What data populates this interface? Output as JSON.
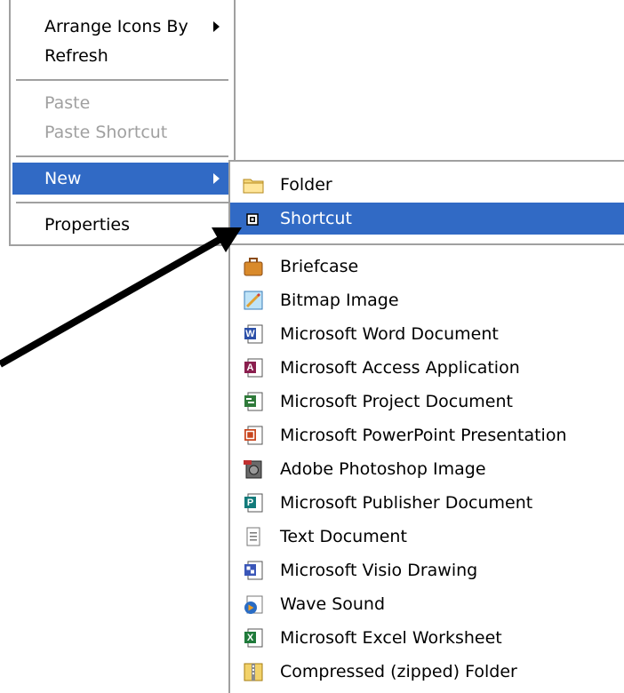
{
  "context_menu": {
    "items": [
      {
        "label": "Arrange Icons By",
        "mnemonic": "I",
        "has_submenu": true,
        "disabled": false
      },
      {
        "label": "Refresh",
        "mnemonic": "e",
        "has_submenu": false,
        "disabled": false
      },
      {
        "label": "Paste",
        "mnemonic": "P",
        "has_submenu": false,
        "disabled": true
      },
      {
        "label": "Paste Shortcut",
        "mnemonic": "S",
        "has_submenu": false,
        "disabled": true
      },
      {
        "label": "New",
        "mnemonic": "w",
        "has_submenu": true,
        "disabled": false,
        "selected": true
      },
      {
        "label": "Properties",
        "mnemonic": "r",
        "has_submenu": false,
        "disabled": false
      }
    ]
  },
  "new_submenu": {
    "items": [
      {
        "label": "Folder",
        "mnemonic": "F",
        "icon": "folder-icon"
      },
      {
        "label": "Shortcut",
        "mnemonic": "S",
        "icon": "shortcut-icon",
        "selected": true
      },
      {
        "label": "Briefcase",
        "icon": "briefcase-icon"
      },
      {
        "label": "Bitmap Image",
        "icon": "bitmap-image-icon"
      },
      {
        "label": "Microsoft Word Document",
        "icon": "word-document-icon"
      },
      {
        "label": "Microsoft Access Application",
        "icon": "access-application-icon"
      },
      {
        "label": "Microsoft Project Document",
        "icon": "project-document-icon"
      },
      {
        "label": "Microsoft PowerPoint Presentation",
        "icon": "powerpoint-presentation-icon"
      },
      {
        "label": "Adobe Photoshop Image",
        "icon": "photoshop-image-icon"
      },
      {
        "label": "Microsoft Publisher Document",
        "icon": "publisher-document-icon"
      },
      {
        "label": "Text Document",
        "icon": "text-document-icon"
      },
      {
        "label": "Microsoft Visio Drawing",
        "icon": "visio-drawing-icon"
      },
      {
        "label": "Wave Sound",
        "icon": "wave-sound-icon"
      },
      {
        "label": "Microsoft Excel Worksheet",
        "icon": "excel-worksheet-icon"
      },
      {
        "label": "Compressed (zipped) Folder",
        "icon": "zipped-folder-icon"
      }
    ]
  },
  "colors": {
    "selection": "#316ac5",
    "disabled_text": "#a0a0a0",
    "menu_border": "#a0a0a0",
    "annotation_arrow": "#000000"
  }
}
